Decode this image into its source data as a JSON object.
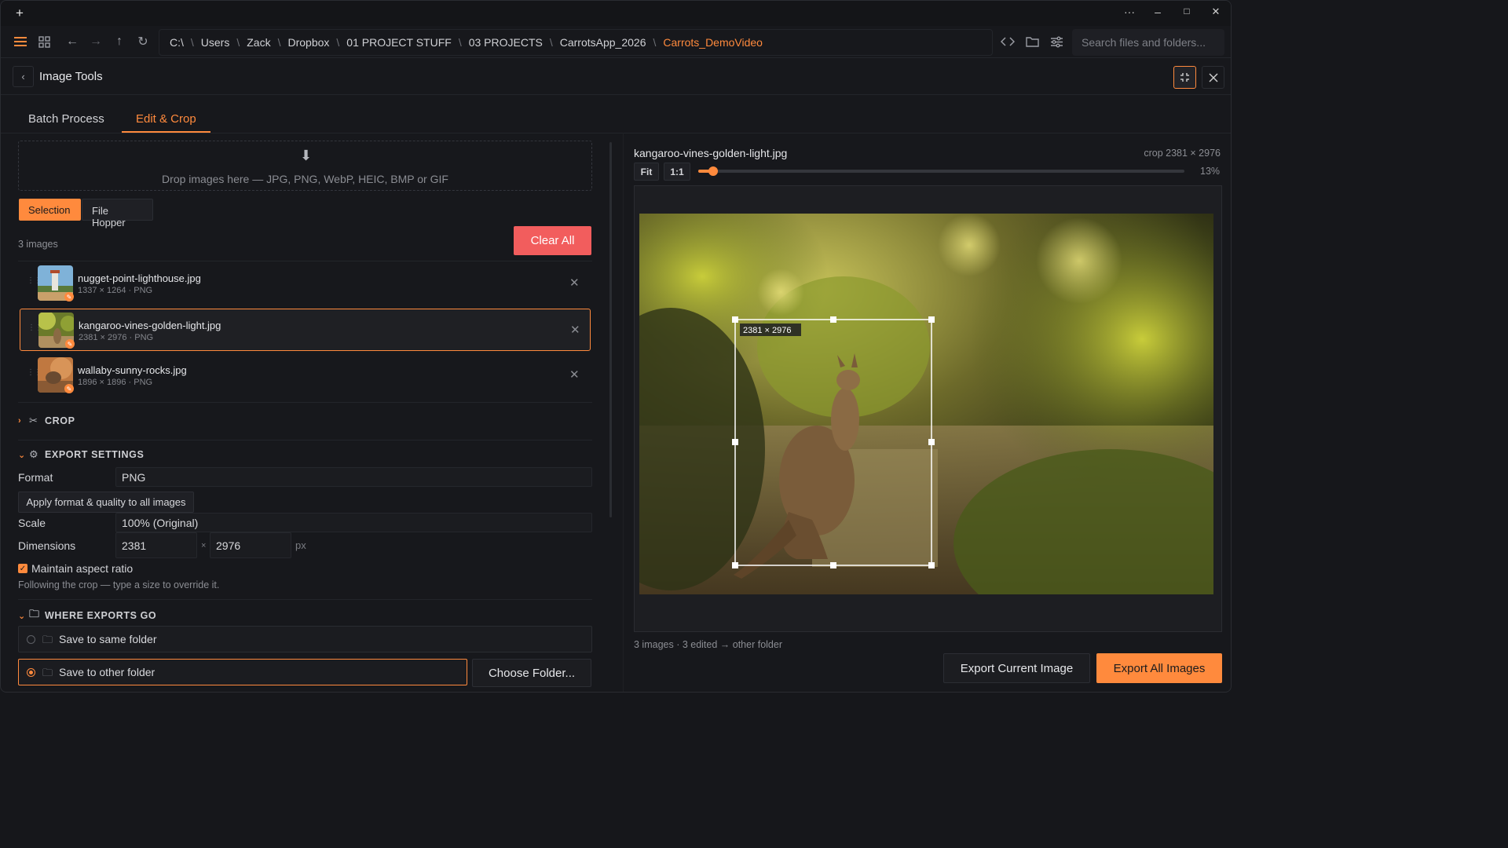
{
  "titlebar": {
    "new_tab": "+",
    "more": "···",
    "minimize": "–",
    "maximize": "□",
    "close": "✕"
  },
  "toolbar": {
    "breadcrumb": [
      "C:\\",
      "Users",
      "Zack",
      "Dropbox",
      "01 PROJECT STUFF",
      "03 PROJECTS",
      "CarrotsApp_2026",
      "Carrots_DemoVideo"
    ],
    "separator": "\\",
    "search_placeholder": "Search files and folders..."
  },
  "panel": {
    "title": "Image Tools",
    "back": "‹"
  },
  "tabs": [
    "Batch Process",
    "Edit & Crop"
  ],
  "drop": {
    "arrow": "⬇",
    "text": "Drop images here — JPG, PNG, WebP, HEIC, BMP or GIF"
  },
  "segments": [
    "Selection",
    "File Hopper"
  ],
  "count": "3 images",
  "clear_all": "Clear All",
  "files": [
    {
      "name": "nugget-point-lighthouse.jpg",
      "meta": "1337 × 1264 · PNG"
    },
    {
      "name": "kangaroo-vines-golden-light.jpg",
      "meta": "2381 × 2976 · PNG"
    },
    {
      "name": "wallaby-sunny-rocks.jpg",
      "meta": "1896 × 1896 · PNG"
    }
  ],
  "sections": {
    "crop": "CROP",
    "export": "EXPORT SETTINGS",
    "where": "WHERE EXPORTS GO"
  },
  "export": {
    "format_label": "Format",
    "format_value": "PNG",
    "apply_button": "Apply format & quality to all images",
    "scale_label": "Scale",
    "scale_value": "100% (Original)",
    "dimensions_label": "Dimensions",
    "width": "2381",
    "height": "2976",
    "times": "×",
    "unit": "px",
    "aspect_label": "Maintain aspect ratio",
    "hint": "Following the crop — type a size to override it."
  },
  "destinations": {
    "same": "Save to same folder",
    "other": "Save to other folder",
    "choose": "Choose Folder..."
  },
  "preview": {
    "filename": "kangaroo-vines-golden-light.jpg",
    "crop_info": "crop 2381 × 2976",
    "fit": "Fit",
    "one_to_one": "1:1",
    "zoom_percent": "13%",
    "zoom_fraction": 0.13,
    "crop_label": "2381 × 2976",
    "footer": "3 images · 3 edited → other folder"
  },
  "actions": {
    "export_current": "Export Current Image",
    "export_all": "Export All Images"
  },
  "colors": {
    "accent": "#ff8a3d",
    "danger": "#f25d5d",
    "background": "#17181c"
  }
}
